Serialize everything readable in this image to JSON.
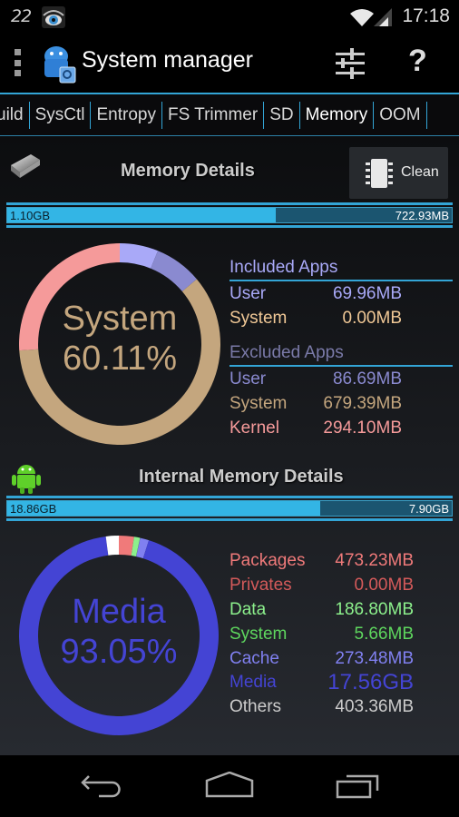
{
  "statusbar": {
    "notification_text": "22",
    "time": "17:18"
  },
  "actionbar": {
    "title": "System manager",
    "overflow_icon": "overflow-menu-icon",
    "settings_icon": "sliders-icon",
    "help_icon": "?"
  },
  "tabs": [
    {
      "label": "uild",
      "active": false
    },
    {
      "label": "SysCtl",
      "active": false
    },
    {
      "label": "Entropy",
      "active": false
    },
    {
      "label": "FS Trimmer",
      "active": false
    },
    {
      "label": "SD",
      "active": false
    },
    {
      "label": "Memory",
      "active": true
    },
    {
      "label": "OOM",
      "active": false
    }
  ],
  "memory": {
    "title": "Memory Details",
    "clean_label": "Clean",
    "bar": {
      "used": "1.10GB",
      "free": "722.93MB",
      "used_fraction": 0.604
    },
    "donut_label": "System",
    "donut_percent": "60.11%",
    "included_title": "Included Apps",
    "included": [
      {
        "name": "User",
        "value": "69.96MB",
        "color": "#a9a9f8"
      },
      {
        "name": "System",
        "value": "0.00MB",
        "color": "#f0c896"
      }
    ],
    "excluded_title": "Excluded Apps",
    "excluded": [
      {
        "name": "User",
        "value": "86.69MB",
        "color": "#8a8ad0"
      },
      {
        "name": "System",
        "value": "679.39MB",
        "color": "#c4a67e"
      },
      {
        "name": "Kernel",
        "value": "294.10MB",
        "color": "#f59a9a"
      }
    ]
  },
  "internal": {
    "title": "Internal Memory Details",
    "bar": {
      "used": "18.86GB",
      "free": "7.90GB",
      "used_fraction": 0.705
    },
    "donut_label": "Media",
    "donut_percent": "93.05%",
    "items": [
      {
        "name": "Packages",
        "value": "473.23MB",
        "color": "#f07a7a"
      },
      {
        "name": "Privates",
        "value": "0.00MB",
        "color": "#d45a5a"
      },
      {
        "name": "Data",
        "value": "186.80MB",
        "color": "#8cf08c"
      },
      {
        "name": "System",
        "value": "5.66MB",
        "color": "#5ed65e"
      },
      {
        "name": "Cache",
        "value": "273.48MB",
        "color": "#8080f0"
      },
      {
        "name": "Media",
        "value": "17.56GB",
        "color": "#4444d4"
      },
      {
        "name": "Others",
        "value": "403.36MB",
        "color": "#cccccc"
      }
    ]
  },
  "chart_data": [
    {
      "type": "pie",
      "title": "Memory Details",
      "center_text": "System 60.11%",
      "categories": [
        "Included User",
        "Included System",
        "Excluded User",
        "Excluded System",
        "Kernel"
      ],
      "values": [
        69.96,
        0.0,
        86.69,
        679.39,
        294.1
      ],
      "colors": [
        "#a9a9f8",
        "#f0c896",
        "#8a8ad0",
        "#c4a67e",
        "#f59a9a"
      ],
      "unit": "MB"
    },
    {
      "type": "pie",
      "title": "Internal Memory Details",
      "center_text": "Media 93.05%",
      "categories": [
        "Packages",
        "Privates",
        "Data",
        "System",
        "Cache",
        "Media",
        "Others"
      ],
      "values": [
        473.23,
        0.0,
        186.8,
        5.66,
        273.48,
        17981.44,
        403.36
      ],
      "colors": [
        "#f07a7a",
        "#d45a5a",
        "#8cf08c",
        "#5ed65e",
        "#8080f0",
        "#4444d4",
        "#ffffff"
      ],
      "unit": "MB"
    }
  ],
  "navbar": {
    "back": "back-icon",
    "home": "home-icon",
    "recents": "recents-icon"
  }
}
